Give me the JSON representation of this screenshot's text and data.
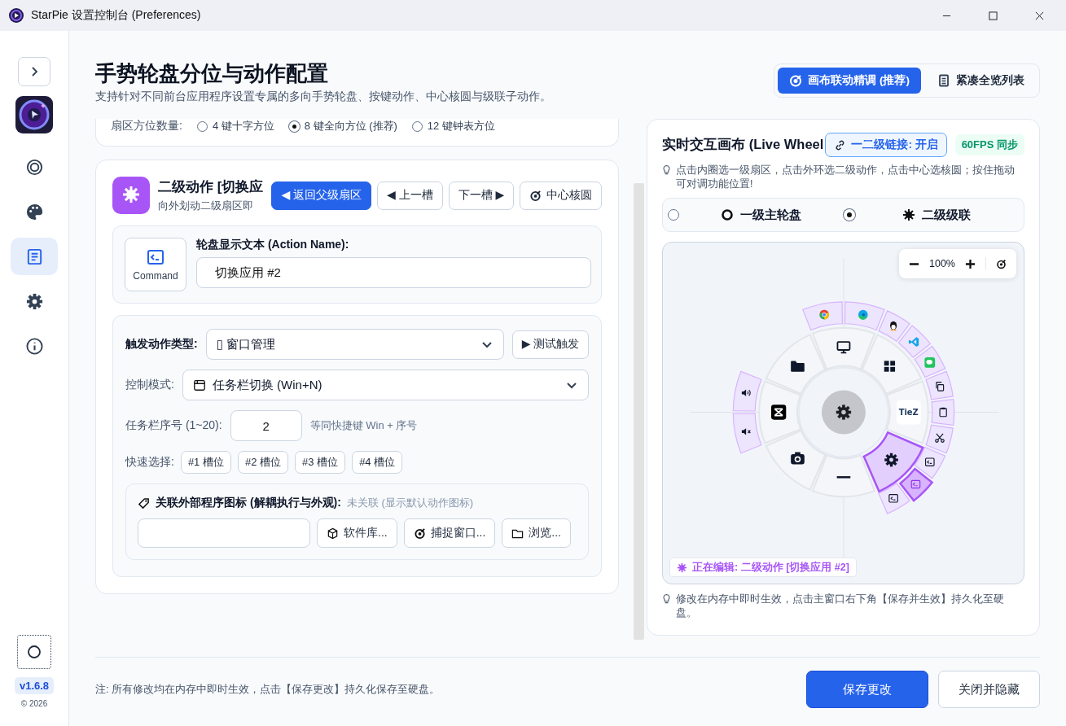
{
  "window": {
    "title": "StarPie 设置控制台 (Preferences)"
  },
  "sidebar": {
    "items": [
      {
        "selected": false
      },
      {
        "selected": false
      },
      {
        "selected": true
      },
      {
        "selected": false
      },
      {
        "selected": false
      }
    ],
    "version": "v1.6.8",
    "copyright": "© 2026"
  },
  "header": {
    "title": "手势轮盘分位与动作配置",
    "subtitle": "支持针对不同前台应用程序设置专属的多向手势轮盘、按键动作、中心核圆与级联子动作。",
    "view_toggle": [
      {
        "label": "画布联动精调 (推荐)",
        "selected": true
      },
      {
        "label": "紧凑全览列表",
        "selected": false
      }
    ]
  },
  "sector_count": {
    "label": "扇区方位数量:",
    "options": [
      {
        "label": "4 键十字方位",
        "selected": false
      },
      {
        "label": "8 键全向方位 (推荐)",
        "selected": true
      },
      {
        "label": "12 键钟表方位",
        "selected": false
      }
    ]
  },
  "editor": {
    "title": "二级动作 [切换应",
    "subtitle": "向外划动二级扇区即",
    "nav_buttons": [
      {
        "label": "◀ 返回父级扇区",
        "primary": true
      },
      {
        "label": "◀ 上一槽",
        "primary": false
      },
      {
        "label": "下一槽 ▶",
        "primary": false
      },
      {
        "label": "中心核圆",
        "primary": false
      }
    ],
    "icon_tile_label": "Command",
    "name_label": "轮盘显示文本 (Action Name):",
    "name_value": "切换应用 #2",
    "trigger_label": "触发动作类型:",
    "trigger_value": "▯ 窗口管理",
    "test_button": "▶ 测试触发",
    "mode_label": "控制模式:",
    "mode_value": "任务栏切换 (Win+N)",
    "slot_label": "任务栏序号 (1~20):",
    "slot_value": "2",
    "slot_hint": "等同快捷键 Win + 序号",
    "quick_label": "快速选择:",
    "quick_chips": [
      "#1 槽位",
      "#2 槽位",
      "#3 槽位",
      "#4 槽位"
    ],
    "link_label": "关联外部程序图标 (解耦执行与外观):",
    "link_status": "未关联 (显示默认动作图标)",
    "link_buttons": [
      "软件库...",
      "捕捉窗口...",
      "浏览..."
    ]
  },
  "canvas": {
    "title": "实时交互画布 (Live Wheel",
    "link_badge": "一二级链接: 开启",
    "fps_badge": "60FPS 同步",
    "hint": "点击内圈选一级扇区，点击外环选二级动作，点击中心选核圆；按住拖动可对调功能位置!",
    "mode_options": [
      {
        "label": "一级主轮盘",
        "selected": false
      },
      {
        "label": "二级级联",
        "selected": true
      }
    ],
    "zoom": "100%",
    "wheel": {
      "sectors": [
        {
          "selected": false,
          "children": [
            {
              "selected": false
            },
            {
              "selected": false
            }
          ]
        },
        {
          "selected": false,
          "children": [
            {
              "selected": false
            },
            {
              "selected": false
            },
            {
              "selected": false
            }
          ]
        },
        {
          "label": "TieZ",
          "selected": false,
          "children": [
            {
              "selected": false
            },
            {
              "selected": false
            },
            {
              "selected": false
            }
          ]
        },
        {
          "selected": true,
          "children": [
            {
              "selected": false
            },
            {
              "selected": true
            },
            {
              "selected": false
            }
          ]
        },
        {
          "selected": false
        },
        {
          "selected": false
        },
        {
          "selected": false,
          "children": [
            {
              "selected": false
            },
            {
              "selected": false
            }
          ]
        },
        {
          "selected": false
        }
      ]
    },
    "editing_badge": "正在编辑: 二级动作 [切换应用 #2]",
    "footnote": "修改在内存中即时生效，点击主窗口右下角【保存并生效】持久化至硬盘。"
  },
  "footer": {
    "note": "注: 所有修改均在内存中即时生效，点击【保存更改】持久化保存至硬盘。",
    "buttons": [
      {
        "label": "保存更改",
        "primary": true
      },
      {
        "label": "关闭并隐藏",
        "primary": false
      }
    ]
  }
}
